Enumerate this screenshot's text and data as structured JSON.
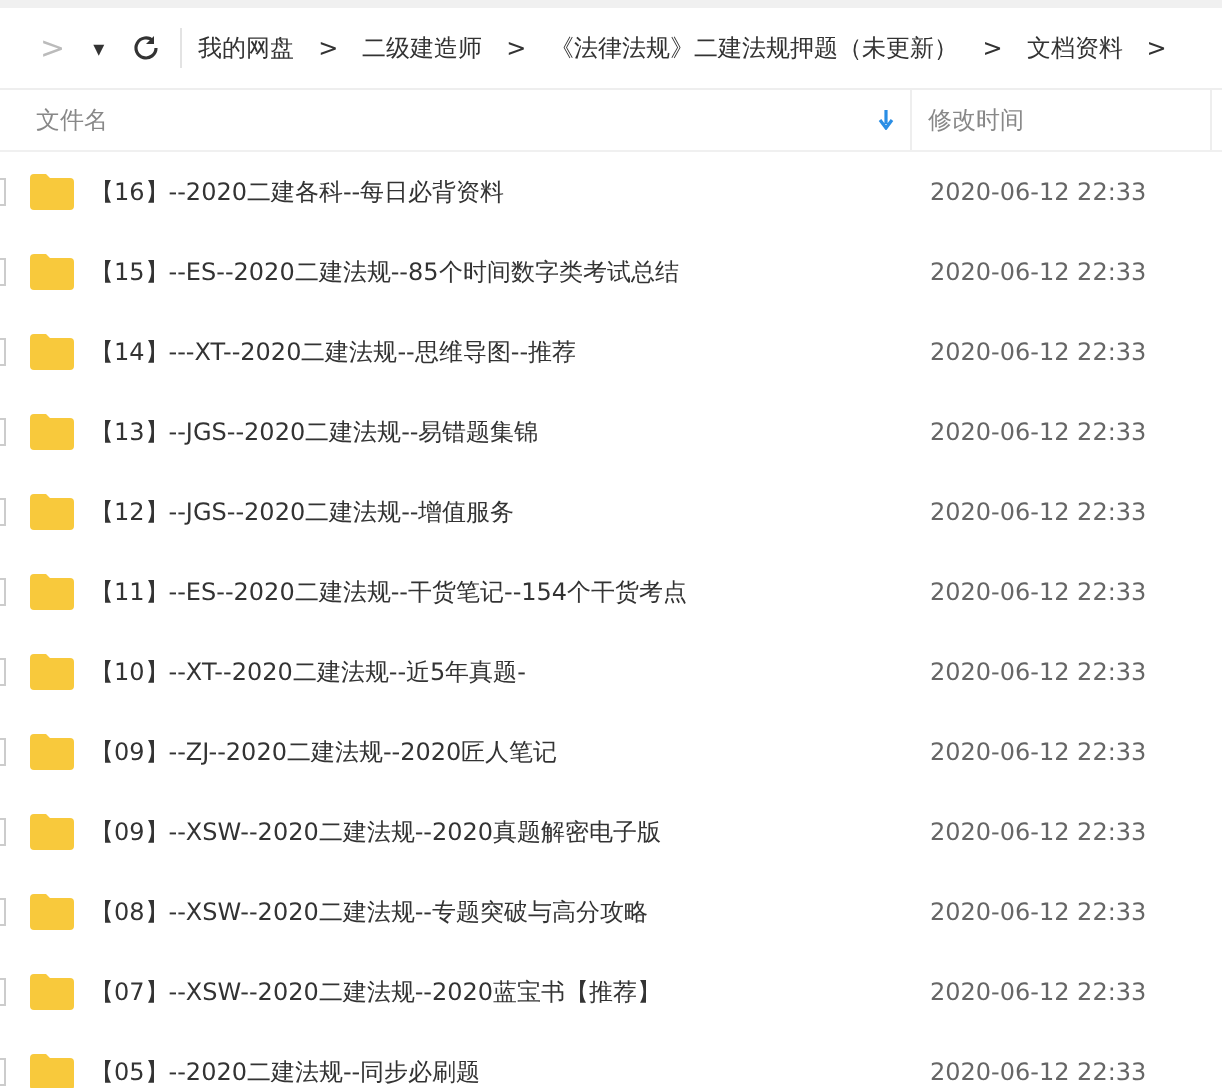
{
  "toolbar": {
    "forward": ">",
    "dropdown": "▾",
    "breadcrumb": [
      {
        "label": "我的网盘",
        "separator": ">"
      },
      {
        "label": "二级建造师",
        "separator": ">"
      },
      {
        "label": "《法律法规》二建法规押题（未更新）",
        "separator": ">"
      },
      {
        "label": "文档资料",
        "separator": ">"
      }
    ]
  },
  "table": {
    "columns": [
      {
        "label": "文件名",
        "sorted": true
      },
      {
        "label": "修改时间",
        "sorted": false
      }
    ],
    "rows": [
      {
        "name": "【16】--2020二建各科--每日必背资料",
        "modified": "2020-06-12 22:33",
        "checked": false
      },
      {
        "name": "【15】--ES--2020二建法规--85个时间数字类考试总结",
        "modified": "2020-06-12 22:33",
        "checked": false
      },
      {
        "name": "【14】---XT--2020二建法规--思维导图--推荐",
        "modified": "2020-06-12 22:33",
        "checked": false
      },
      {
        "name": "【13】--JGS--2020二建法规--易错题集锦",
        "modified": "2020-06-12 22:33",
        "checked": false
      },
      {
        "name": "【12】--JGS--2020二建法规--增值服务",
        "modified": "2020-06-12 22:33",
        "checked": false
      },
      {
        "name": "【11】--ES--2020二建法规--干货笔记--154个干货考点",
        "modified": "2020-06-12 22:33",
        "checked": false
      },
      {
        "name": "【10】--XT--2020二建法规--近5年真题-",
        "modified": "2020-06-12 22:33",
        "checked": false
      },
      {
        "name": "【09】--ZJ--2020二建法规--2020匠人笔记",
        "modified": "2020-06-12 22:33",
        "checked": false
      },
      {
        "name": "【09】--XSW--2020二建法规--2020真题解密电子版",
        "modified": "2020-06-12 22:33",
        "checked": false
      },
      {
        "name": "【08】--XSW--2020二建法规--专题突破与高分攻略",
        "modified": "2020-06-12 22:33",
        "checked": false
      },
      {
        "name": "【07】--XSW--2020二建法规--2020蓝宝书【推荐】",
        "modified": "2020-06-12 22:33",
        "checked": false
      },
      {
        "name": "【05】--2020二建法规--同步必刷题",
        "modified": "2020-06-12 22:33",
        "checked": false
      }
    ]
  }
}
